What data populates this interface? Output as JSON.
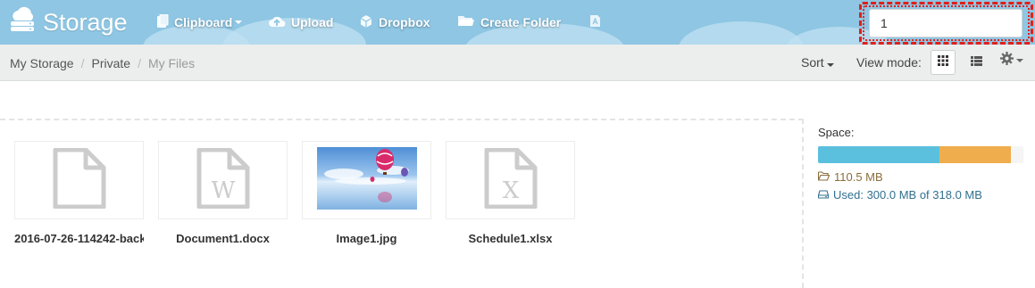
{
  "app": {
    "title": "Storage",
    "logo_icon": "cloud-server-icon"
  },
  "toolbar": {
    "clipboard_label": "Clipboard",
    "upload_label": "Upload",
    "dropbox_label": "Dropbox",
    "create_folder_label": "Create Folder"
  },
  "search": {
    "value": "1"
  },
  "breadcrumb": [
    "My Storage",
    "Private",
    "My Files"
  ],
  "controls": {
    "sort_label": "Sort",
    "view_mode_label": "View mode:",
    "active_view": "grid"
  },
  "files": [
    {
      "name": "2016-07-26-114242-back",
      "type": "generic",
      "icon": "file-icon"
    },
    {
      "name": "Document1.docx",
      "type": "word",
      "icon": "word-file-icon"
    },
    {
      "name": "Image1.jpg",
      "type": "image",
      "icon": "image-thumbnail"
    },
    {
      "name": "Schedule1.xlsx",
      "type": "excel",
      "icon": "excel-file-icon"
    }
  ],
  "storage": {
    "label": "Space:",
    "folder_size": "110.5 MB",
    "used_text": "Used: 300.0 MB of 318.0 MB",
    "used_fraction_blue": 0.59,
    "used_fraction_orange": 0.35
  },
  "colors": {
    "topbar": "#8ec6e3",
    "progress_blue": "#5bc0de",
    "progress_orange": "#f0ad4e",
    "link_blue": "#31708f",
    "folder_brown": "#8a6d3b",
    "highlight_red": "#e0201a"
  }
}
